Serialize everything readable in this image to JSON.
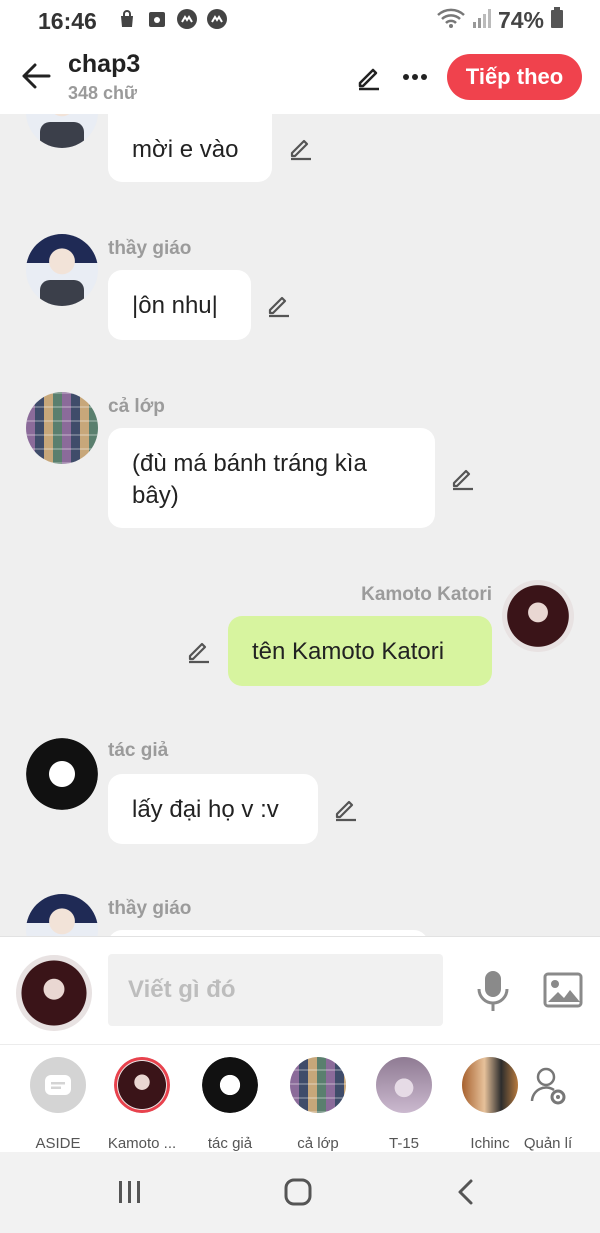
{
  "status_bar": {
    "time": "16:46",
    "battery": "74%"
  },
  "header": {
    "title": "chap3",
    "subtitle": "348 chữ",
    "next_label": "Tiếp theo"
  },
  "messages": [
    {
      "sender": "",
      "text": "mời e vào"
    },
    {
      "sender": "thầy giáo",
      "text": "|ôn nhu|"
    },
    {
      "sender": "cả lớp",
      "text": "(đù má bánh tráng kìa bây)"
    },
    {
      "sender": "Kamoto Katori",
      "text": "tên Kamoto Katori"
    },
    {
      "sender": "tác giả",
      "text": "lấy đại họ v :v"
    },
    {
      "sender": "thầy giáo",
      "text": ""
    }
  ],
  "input": {
    "placeholder": "Viết gì đó"
  },
  "characters": [
    {
      "label": "ASIDE"
    },
    {
      "label": "Kamoto ..."
    },
    {
      "label": "tác giả"
    },
    {
      "label": "cả lớp"
    },
    {
      "label": "T-15"
    },
    {
      "label": "Ichinc"
    },
    {
      "label": "Quản lí"
    }
  ],
  "colors": {
    "accent": "#f0424d",
    "my_bubble": "#d7f49f",
    "bubble": "#ffffff",
    "background": "#efefef"
  }
}
